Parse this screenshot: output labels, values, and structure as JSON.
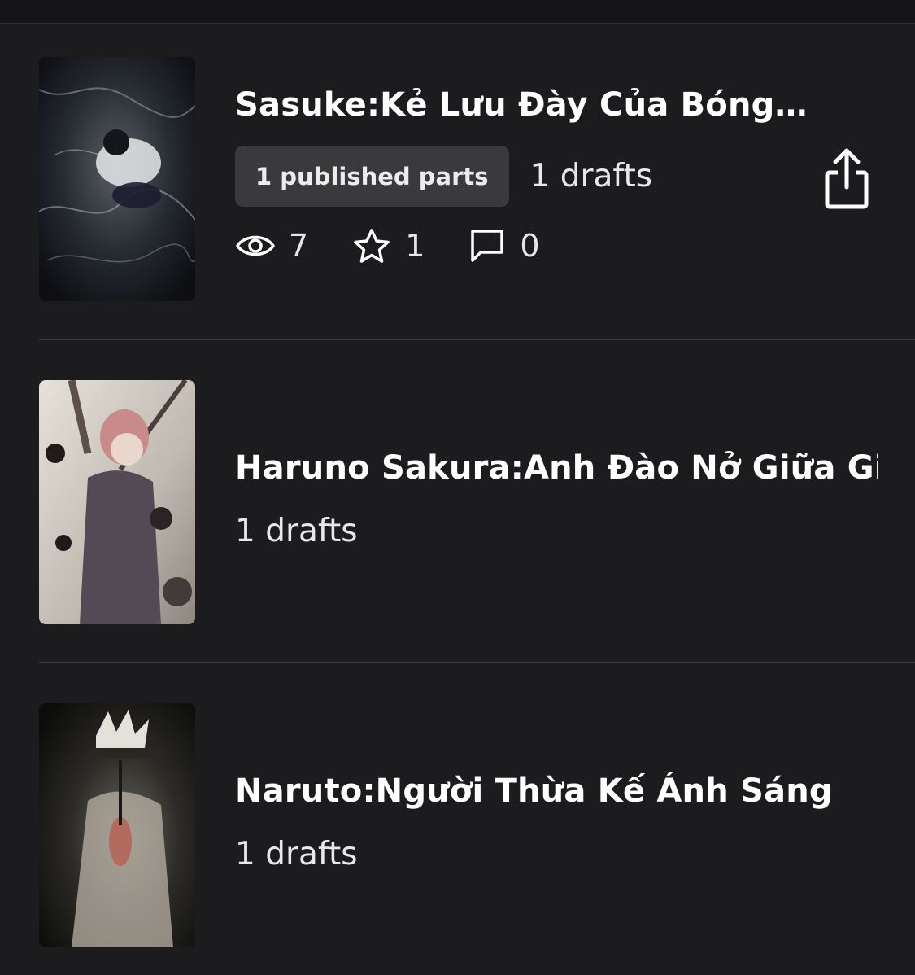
{
  "stories": [
    {
      "title": "Sasuke:Kẻ Lưu Đày Của Bóng…",
      "published_badge": "1 published parts",
      "drafts": "1 drafts",
      "stats": {
        "views": "7",
        "votes": "1",
        "comments": "0"
      }
    },
    {
      "title": "Haruno Sakura:Anh Đào Nở Giữa Gi…",
      "drafts": "1 drafts"
    },
    {
      "title": "Naruto:Người Thừa Kế Ánh Sáng",
      "drafts": "1 drafts"
    }
  ],
  "icons": {
    "views": "eye-icon",
    "votes": "star-icon",
    "comments": "comment-icon",
    "share": "share-icon"
  },
  "colors": {
    "background": "#1c1c1e",
    "badge": "#3a3a3d",
    "divider": "#38383b"
  }
}
